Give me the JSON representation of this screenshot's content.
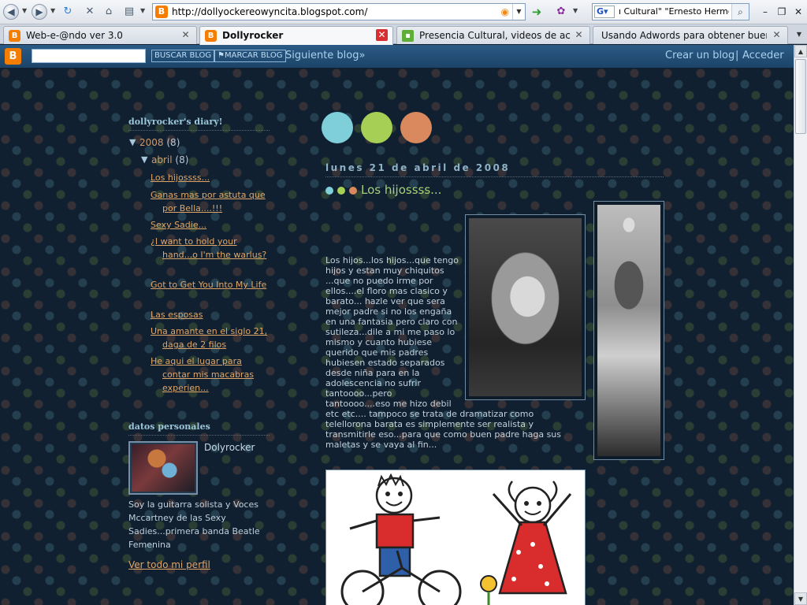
{
  "browser": {
    "url": "http://dollyockereowyncita.blogspot.com/",
    "search_engine_label": "G",
    "search_query": "ı Cultural\" \"Ernesto Hermoza\"",
    "tabs": [
      {
        "label": "Web-e-@ndo ver 3.0",
        "icon": "blogger-icon",
        "active": false
      },
      {
        "label": "Dollyrocker",
        "icon": "blogger-icon",
        "active": true
      },
      {
        "label": "Presencia Cultural, videos de actualid...",
        "icon": "chat-icon",
        "active": false
      },
      {
        "label": "Usando Adwords para obtener buenos ke...",
        "icon": "none",
        "active": false
      }
    ]
  },
  "blogger_nav": {
    "search_button": "BUSCAR BLOG",
    "flag_button": "MARCAR BLOG",
    "next_blog": "Siguiente blog»",
    "create_blog": "Crear un blog",
    "separator": "|",
    "sign_in": "Acceder"
  },
  "sidebar": {
    "archive_heading": "dollyrocker's diary!",
    "year": {
      "label": "2008",
      "count": "(8)",
      "toggle": "▼"
    },
    "month": {
      "label": "abril",
      "count": "(8)",
      "toggle": "▼"
    },
    "posts": [
      "Los hijossss...",
      "Ganas mas por astuta que por Bella....!!!",
      "Sexy Sadie...",
      "¿I want to hold your hand...o I'm the warlus?",
      "Got to Get You Into My Life",
      "Las esposas",
      "Una amante en el siglo 21, daga de 2 filos",
      "He aqui el lugar para contar mis macabras experien..."
    ],
    "profile_heading": "datos personales",
    "profile_name": "Dolyrocker",
    "profile_bio": "Soy la guitarra solista y Voces Mccartney de las Sexy Sadies...primera banda Beatle Femenina",
    "profile_link": "Ver todo mi perfil"
  },
  "post": {
    "date": "lunes 21 de abril de 2008",
    "title": "Los hijossss...",
    "body_narrow": "Los hijos...los hijos...que tengo hijos y estan muy chiquitos ...que no puedo irme por ellos....el floro mas clasico y barato... hazle ver que sera mejor padre si no los engaña en una fantasia pero claro con sutileza...dile a mi me paso lo mismo y cuanto hubiese querido que mis padres hubiesen estado separados desde niña para en la adolescencia no sufrir tantoooo...pero tantoooo....eso me hizo debil",
    "body_wide": "etc etc.... tampoco se trata de dramatizar como telellorona barata es simplemente ser realista y transmitirle eso...para que como buen padre haga sus maletas y se vaya al fin..."
  },
  "colors": {
    "dot_blue": "#7ecfd9",
    "dot_green": "#a6cf55",
    "dot_orange": "#d9895d",
    "link": "#e0a668",
    "title": "#a5d17a"
  }
}
